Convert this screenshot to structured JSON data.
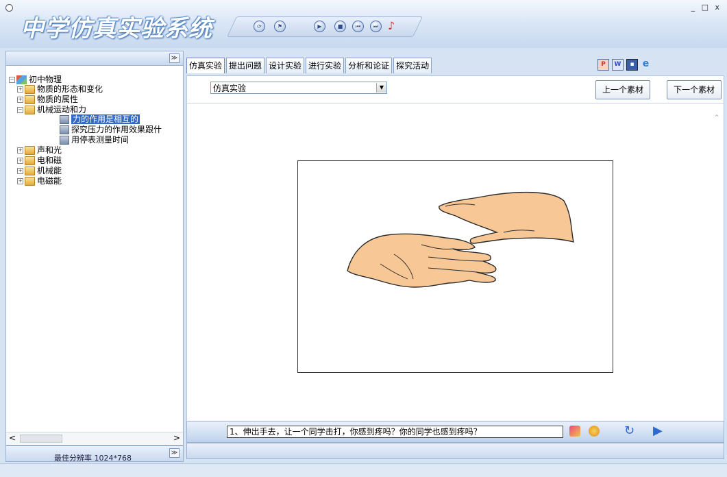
{
  "app": {
    "title": "中学仿真实验系统",
    "window_controls": "_ □ x",
    "accent": "#3169c6"
  },
  "toolstrip": {
    "icons": [
      "refresh-icon",
      "flag-icon",
      "play-icon",
      "stop-icon",
      "rewind-icon",
      "forward-icon",
      "music-icon"
    ]
  },
  "sidebar": {
    "collapse": "≫",
    "tree": [
      {
        "label": "初中物理",
        "level": 0,
        "type": "root",
        "expanded": true
      },
      {
        "label": "物质的形态和变化",
        "level": 1,
        "type": "folder",
        "expanded": false
      },
      {
        "label": "物质的属性",
        "level": 1,
        "type": "folder",
        "expanded": false
      },
      {
        "label": "机械运动和力",
        "level": 1,
        "type": "folder",
        "expanded": true
      },
      {
        "label": "力的作用是相互的",
        "level": 2,
        "type": "leaf",
        "selected": true
      },
      {
        "label": "探究压力的作用效果跟什",
        "level": 2,
        "type": "leaf"
      },
      {
        "label": "用停表测量时间",
        "level": 2,
        "type": "leaf"
      },
      {
        "label": "声和光",
        "level": 1,
        "type": "folder",
        "expanded": false
      },
      {
        "label": "电和磁",
        "level": 1,
        "type": "folder",
        "expanded": false
      },
      {
        "label": "机械能",
        "level": 1,
        "type": "folder",
        "expanded": false
      },
      {
        "label": "电磁能",
        "level": 1,
        "type": "folder",
        "expanded": false
      }
    ],
    "footer_text": "最佳分辨率 1024*768",
    "scroll_left": "<",
    "scroll_right": ">"
  },
  "tabs": [
    {
      "label": "仿真实验",
      "active": true
    },
    {
      "label": "提出问题"
    },
    {
      "label": "设计实验"
    },
    {
      "label": "进行实验"
    },
    {
      "label": "分析和论证"
    },
    {
      "label": "探究活动"
    }
  ],
  "toolbar": {
    "combo_value": "仿真实验",
    "prev_label": "上一个素材",
    "next_label": "下一个素材",
    "right_icons": [
      "powerpoint-icon",
      "word-icon",
      "save-icon",
      "ie-icon"
    ]
  },
  "caption": {
    "text": "1、伸出手去，让一个同学击打，你感到疼吗？你的同学也感到疼吗？"
  }
}
